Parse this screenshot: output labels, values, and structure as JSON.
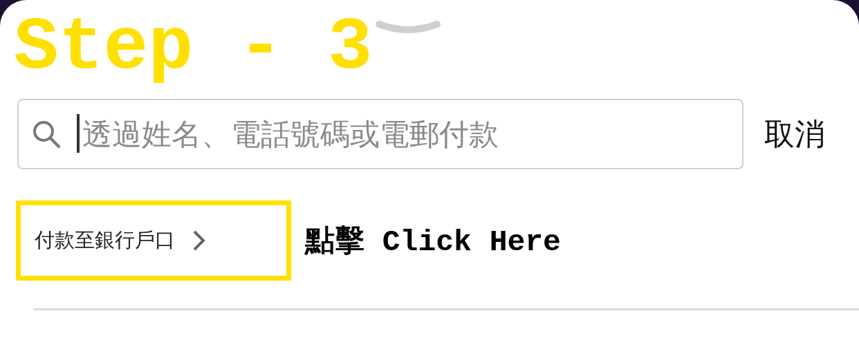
{
  "annotation_title": "Step - 3",
  "search": {
    "placeholder": "透過姓名、電話號碼或電郵付款"
  },
  "cancel_button": "取消",
  "bank_transfer_link": {
    "label": "付款至銀行戶口",
    "highlighted": true
  },
  "annotation_callout": "點擊 Click Here"
}
